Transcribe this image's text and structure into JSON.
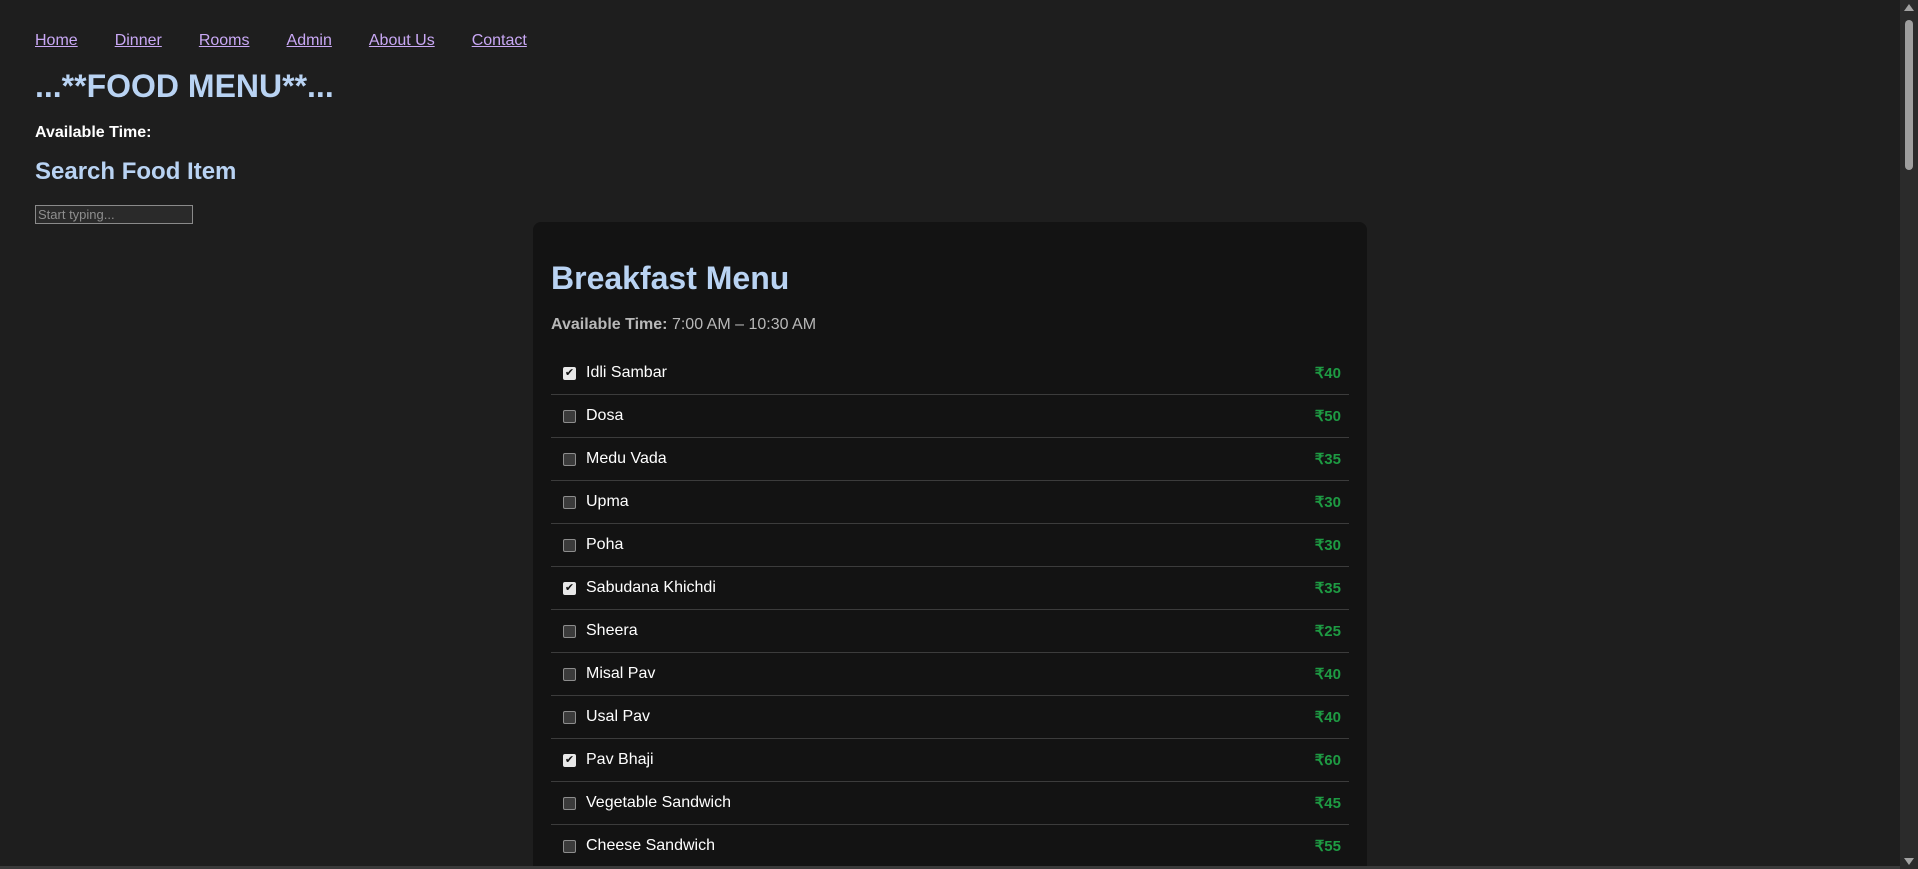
{
  "nav": {
    "links": [
      "Home",
      "Dinner",
      "Rooms",
      "Admin",
      "About Us",
      "Contact"
    ]
  },
  "header": {
    "title": "...**FOOD MENU**...",
    "available_time_label": "Available Time:"
  },
  "search": {
    "heading": "Search Food Item",
    "placeholder": "Start typing...",
    "value": ""
  },
  "menu": {
    "title": "Breakfast Menu",
    "available_label": "Available Time:",
    "available_value": "7:00 AM – 10:30 AM",
    "items": [
      {
        "name": "Idli Sambar",
        "price": "₹40",
        "checked": true
      },
      {
        "name": "Dosa",
        "price": "₹50",
        "checked": false
      },
      {
        "name": "Medu Vada",
        "price": "₹35",
        "checked": false
      },
      {
        "name": "Upma",
        "price": "₹30",
        "checked": false
      },
      {
        "name": "Poha",
        "price": "₹30",
        "checked": false
      },
      {
        "name": "Sabudana Khichdi",
        "price": "₹35",
        "checked": true
      },
      {
        "name": "Sheera",
        "price": "₹25",
        "checked": false
      },
      {
        "name": "Misal Pav",
        "price": "₹40",
        "checked": false
      },
      {
        "name": "Usal Pav",
        "price": "₹40",
        "checked": false
      },
      {
        "name": "Pav Bhaji",
        "price": "₹60",
        "checked": true
      },
      {
        "name": "Vegetable Sandwich",
        "price": "₹45",
        "checked": false
      },
      {
        "name": "Cheese Sandwich",
        "price": "₹55",
        "checked": false
      }
    ]
  },
  "colors": {
    "background": "#1e1e1e",
    "card": "#131313",
    "heading": "#b9d3f3",
    "link": "#c9a8f5",
    "price": "#1e9b43"
  }
}
